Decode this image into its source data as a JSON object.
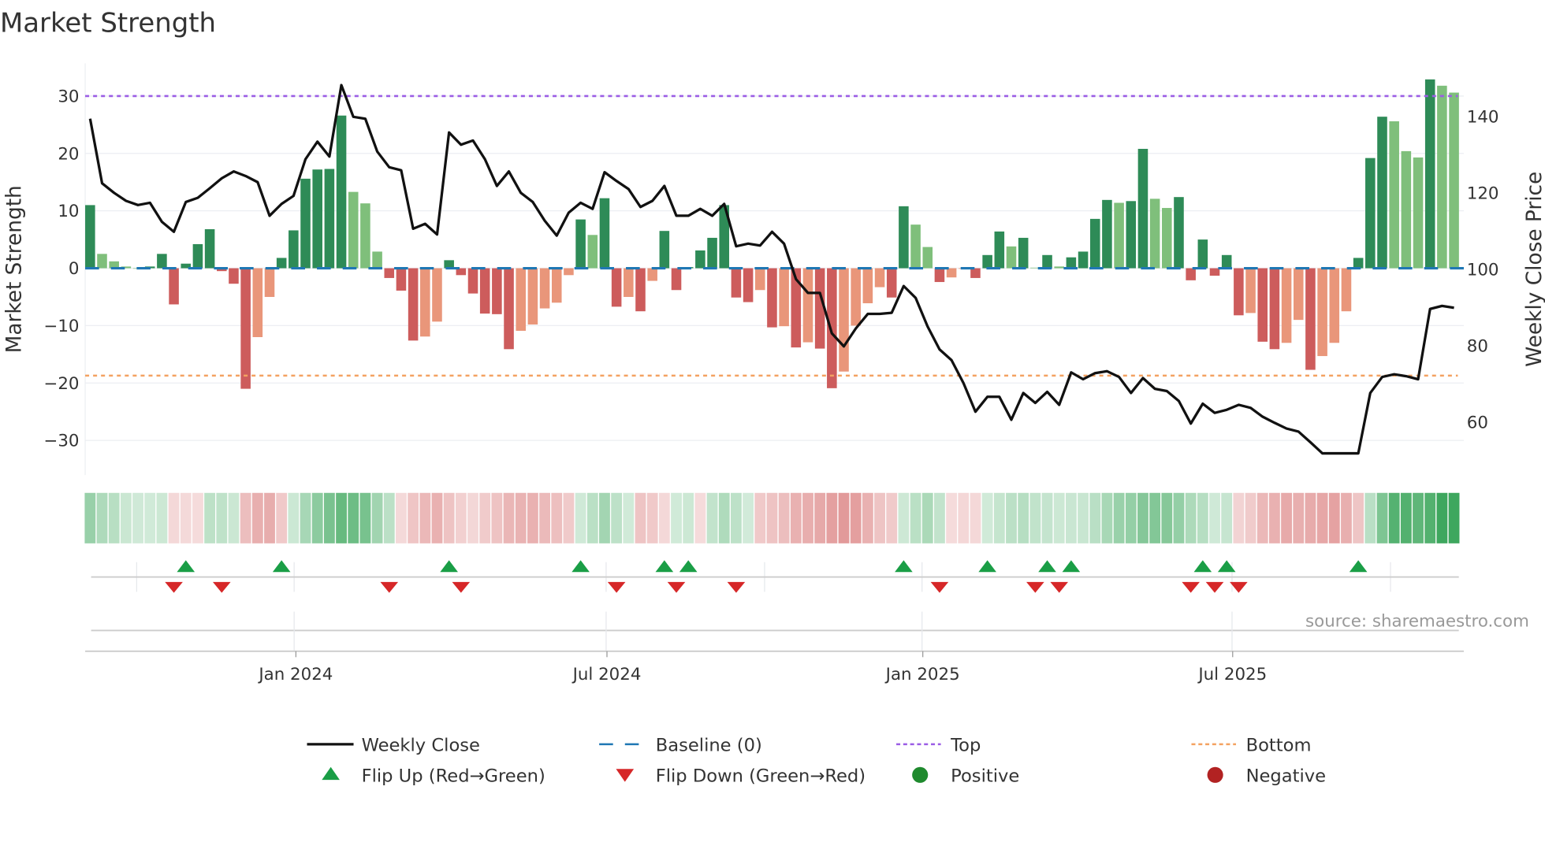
{
  "chart_data": {
    "type": "bar",
    "title": "Market Strength",
    "ylabel": "Market Strength",
    "y2label": "Weekly Close Price",
    "ylim": [
      -36,
      36
    ],
    "y2lim": [
      47,
      155
    ],
    "yticks": [
      "30",
      "20",
      "10",
      "0",
      "−10",
      "−20",
      "−30"
    ],
    "ytick_values": [
      30,
      20,
      10,
      0,
      -10,
      -20,
      -30
    ],
    "y2ticks": [
      "140",
      "120",
      "100",
      "80",
      "60"
    ],
    "y2tick_values": [
      140,
      120,
      100,
      80,
      60
    ],
    "xticks": [
      "Jan 2024",
      "Jul 2024",
      "Jan 2025",
      "Jul 2025"
    ],
    "xtick_week_index": [
      17.2,
      43.2,
      69.6,
      95.5
    ],
    "frequency": "weekly",
    "top_level": 30,
    "bottom_level": -18.7,
    "baseline": 0,
    "strength": [
      11,
      2.5,
      1.2,
      0.3,
      0,
      0.3,
      2.5,
      -6.3,
      0.8,
      4.2,
      6.8,
      -0.5,
      -2.7,
      -21,
      -12,
      -5,
      1.8,
      6.6,
      15.6,
      17.2,
      17.3,
      26.6,
      13.3,
      11.3,
      2.9,
      -1.7,
      -3.9,
      -12.6,
      -11.9,
      -9.3,
      1.4,
      -1.2,
      -4.4,
      -7.9,
      -8.0,
      -14.1,
      -10.9,
      -9.8,
      -7.0,
      -6.0,
      -1.2,
      8.5,
      5.8,
      12.2,
      -6.7,
      -5.0,
      -7.5,
      -2.2,
      6.5,
      -3.8,
      0.2,
      3.1,
      5.3,
      11,
      -5.1,
      -5.9,
      -3.8,
      -10.3,
      -10.1,
      -13.8,
      -12.9,
      -14,
      -20.9,
      -18,
      -10,
      -6.1,
      -3.3,
      -5.1,
      10.8,
      7.6,
      3.7,
      -2.4,
      -1.6,
      -0.1,
      -1.7,
      2.3,
      6.4,
      3.8,
      5.3,
      0.1,
      2.3,
      0.3,
      1.9,
      2.9,
      8.6,
      11.9,
      11.4,
      11.7,
      20.8,
      12.1,
      10.5,
      12.4,
      -2.1,
      5,
      -1.3,
      2.3,
      -8.2,
      -7.8,
      -12.8,
      -14.1,
      -13,
      -9,
      -17.7,
      -15.3,
      -13,
      -7.5,
      1.8,
      19.2,
      26.4,
      25.6,
      20.4,
      19.3,
      32.9,
      31.8,
      30.6
    ],
    "weekly_close": [
      139.4,
      122.5,
      120,
      117.9,
      116.8,
      117.4,
      112.4,
      109.8,
      117.6,
      118.7,
      121.2,
      123.8,
      125.6,
      124.4,
      122.8,
      114,
      117.1,
      119.2,
      128.8,
      133.4,
      129.5,
      148.2,
      139.9,
      139.4,
      130.8,
      126.7,
      125.9,
      110.6,
      111.9,
      109.1,
      135.8,
      132.6,
      133.7,
      128.8,
      121.8,
      125.6,
      120,
      117.6,
      112.7,
      108.8,
      114.8,
      117.4,
      115.8,
      125.4,
      123.1,
      121,
      116.3,
      117.9,
      121.8,
      114,
      114,
      115.8,
      114,
      117.1,
      106,
      106.7,
      106.2,
      109.8,
      106.7,
      97.4,
      93.8,
      93.8,
      83.2,
      79.8,
      84.5,
      88.3,
      88.3,
      88.6,
      95.6,
      92.5,
      85,
      79,
      76.2,
      70.2,
      62.7,
      66.6,
      66.6,
      60.6,
      67.6,
      65,
      67.9,
      64.5,
      73,
      71.2,
      72.8,
      73.3,
      71.8,
      67.6,
      71.5,
      68.7,
      68.1,
      65.5,
      59.6,
      64.8,
      62.4,
      63.2,
      64.5,
      63.7,
      61.4,
      59.8,
      58.3,
      57.5,
      54.7,
      51.8,
      51.8,
      51.8,
      51.8,
      67.6,
      71.8,
      72.5,
      72,
      71.2,
      89.6,
      90.4,
      89.9
    ],
    "flip_up_weeks": [
      8,
      16,
      30,
      41,
      48,
      50,
      68,
      75,
      80,
      82,
      93,
      95,
      106
    ],
    "flip_down_weeks": [
      7,
      11,
      25,
      31,
      44,
      49,
      54,
      71,
      79,
      81,
      92,
      94,
      96
    ],
    "legend": [
      {
        "label": "Weekly Close",
        "type": "line",
        "color": "#111111"
      },
      {
        "label": "Baseline (0)",
        "type": "dash",
        "color": "#1f77b4"
      },
      {
        "label": "Top",
        "type": "dot",
        "color": "#9b5de5"
      },
      {
        "label": "Bottom",
        "type": "dot",
        "color": "#f4a261"
      },
      {
        "label": "Flip Up (Red→Green)",
        "type": "triangle-up",
        "color": "#1a9e46"
      },
      {
        "label": "Flip Down (Green→Red)",
        "type": "triangle-down",
        "color": "#d62728"
      },
      {
        "label": "Positive",
        "type": "circle",
        "color": "#1f8a2e"
      },
      {
        "label": "Negative",
        "type": "circle",
        "color": "#b22222"
      }
    ],
    "legend_position": "bottom-center",
    "grid": true
  },
  "source": "source: sharemaestro.com",
  "colors": {
    "green_dark": "#2e8b57",
    "green_light": "#7fbf7b",
    "red_dark": "#cd5c5c",
    "red_light": "#e9967a",
    "baseline": "#1f77b4",
    "top": "#9b5de5",
    "bottom": "#f4a261",
    "line": "#111111"
  }
}
